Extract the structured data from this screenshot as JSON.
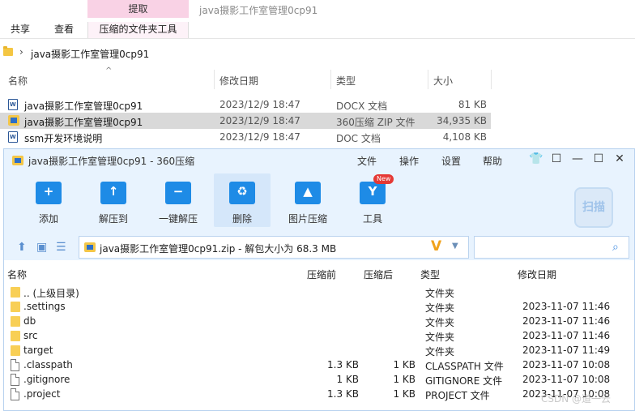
{
  "explorer": {
    "context_tab_header": "提取",
    "window_title": "java摄影工作室管理0cp91",
    "tabs": [
      {
        "label": "共享"
      },
      {
        "label": "查看"
      },
      {
        "label": "压缩的文件夹工具"
      }
    ],
    "address": {
      "path": "java摄影工作室管理0cp91"
    },
    "columns": {
      "name": "名称",
      "modified": "修改日期",
      "type": "类型",
      "size": "大小"
    },
    "files": [
      {
        "name": "java摄影工作室管理0cp91",
        "modified": "2023/12/9 18:47",
        "type": "DOCX 文档",
        "size": "81 KB",
        "icon": "word-doc-icon"
      },
      {
        "name": "java摄影工作室管理0cp91",
        "modified": "2023/12/9 18:47",
        "type": "360压缩 ZIP 文件",
        "size": "34,935 KB",
        "icon": "zip-icon"
      },
      {
        "name": "ssm开发环境说明",
        "modified": "2023/12/9 18:47",
        "type": "DOC 文档",
        "size": "4,108 KB",
        "icon": "word-doc-icon"
      }
    ]
  },
  "zip": {
    "title": "java摄影工作室管理0cp91 - 360压缩",
    "menu": [
      {
        "label": "文件"
      },
      {
        "label": "操作"
      },
      {
        "label": "设置"
      },
      {
        "label": "帮助"
      }
    ],
    "toolbar": [
      {
        "label": "添加",
        "glyph": "+"
      },
      {
        "label": "解压到",
        "glyph": "↑"
      },
      {
        "label": "一键解压",
        "glyph": "−"
      },
      {
        "label": "删除",
        "glyph": "♻"
      },
      {
        "label": "图片压缩",
        "glyph": "▲"
      },
      {
        "label": "工具",
        "glyph": "Y"
      }
    ],
    "new_badge": "New",
    "scan_label": "扫描",
    "path_text": "java摄影工作室管理0cp91.zip - 解包大小为 68.3 MB",
    "columns": {
      "name": "名称",
      "compressed_before": "压缩前",
      "compressed_after": "压缩后",
      "type": "类型",
      "modified": "修改日期"
    },
    "rows": [
      {
        "name": ".. (上级目录)",
        "before": "",
        "after": "",
        "type": "文件夹",
        "modified": "",
        "icon": "folder-icon"
      },
      {
        "name": ".settings",
        "before": "",
        "after": "",
        "type": "文件夹",
        "modified": "2023-11-07 11:46",
        "icon": "folder-icon"
      },
      {
        "name": "db",
        "before": "",
        "after": "",
        "type": "文件夹",
        "modified": "2023-11-07 11:46",
        "icon": "folder-icon"
      },
      {
        "name": "src",
        "before": "",
        "after": "",
        "type": "文件夹",
        "modified": "2023-11-07 11:46",
        "icon": "folder-icon"
      },
      {
        "name": "target",
        "before": "",
        "after": "",
        "type": "文件夹",
        "modified": "2023-11-07 11:49",
        "icon": "folder-icon"
      },
      {
        "name": ".classpath",
        "before": "1.3 KB",
        "after": "1 KB",
        "type": "CLASSPATH 文件",
        "modified": "2023-11-07 10:08",
        "icon": "file-icon"
      },
      {
        "name": ".gitignore",
        "before": "1 KB",
        "after": "1 KB",
        "type": "GITIGNORE 文件",
        "modified": "2023-11-07 10:08",
        "icon": "file-icon"
      },
      {
        "name": ".project",
        "before": "1.3 KB",
        "after": "1 KB",
        "type": "PROJECT 文件",
        "modified": "2023-11-07 10:08",
        "icon": "file-icon"
      }
    ]
  },
  "watermark": "CSDN @道一云",
  "colors": {
    "accent": "#1e8be6",
    "context_tab": "#f9d2e5",
    "zip_bg": "#e8f3fe",
    "selected_row": "#d9d9d9"
  }
}
